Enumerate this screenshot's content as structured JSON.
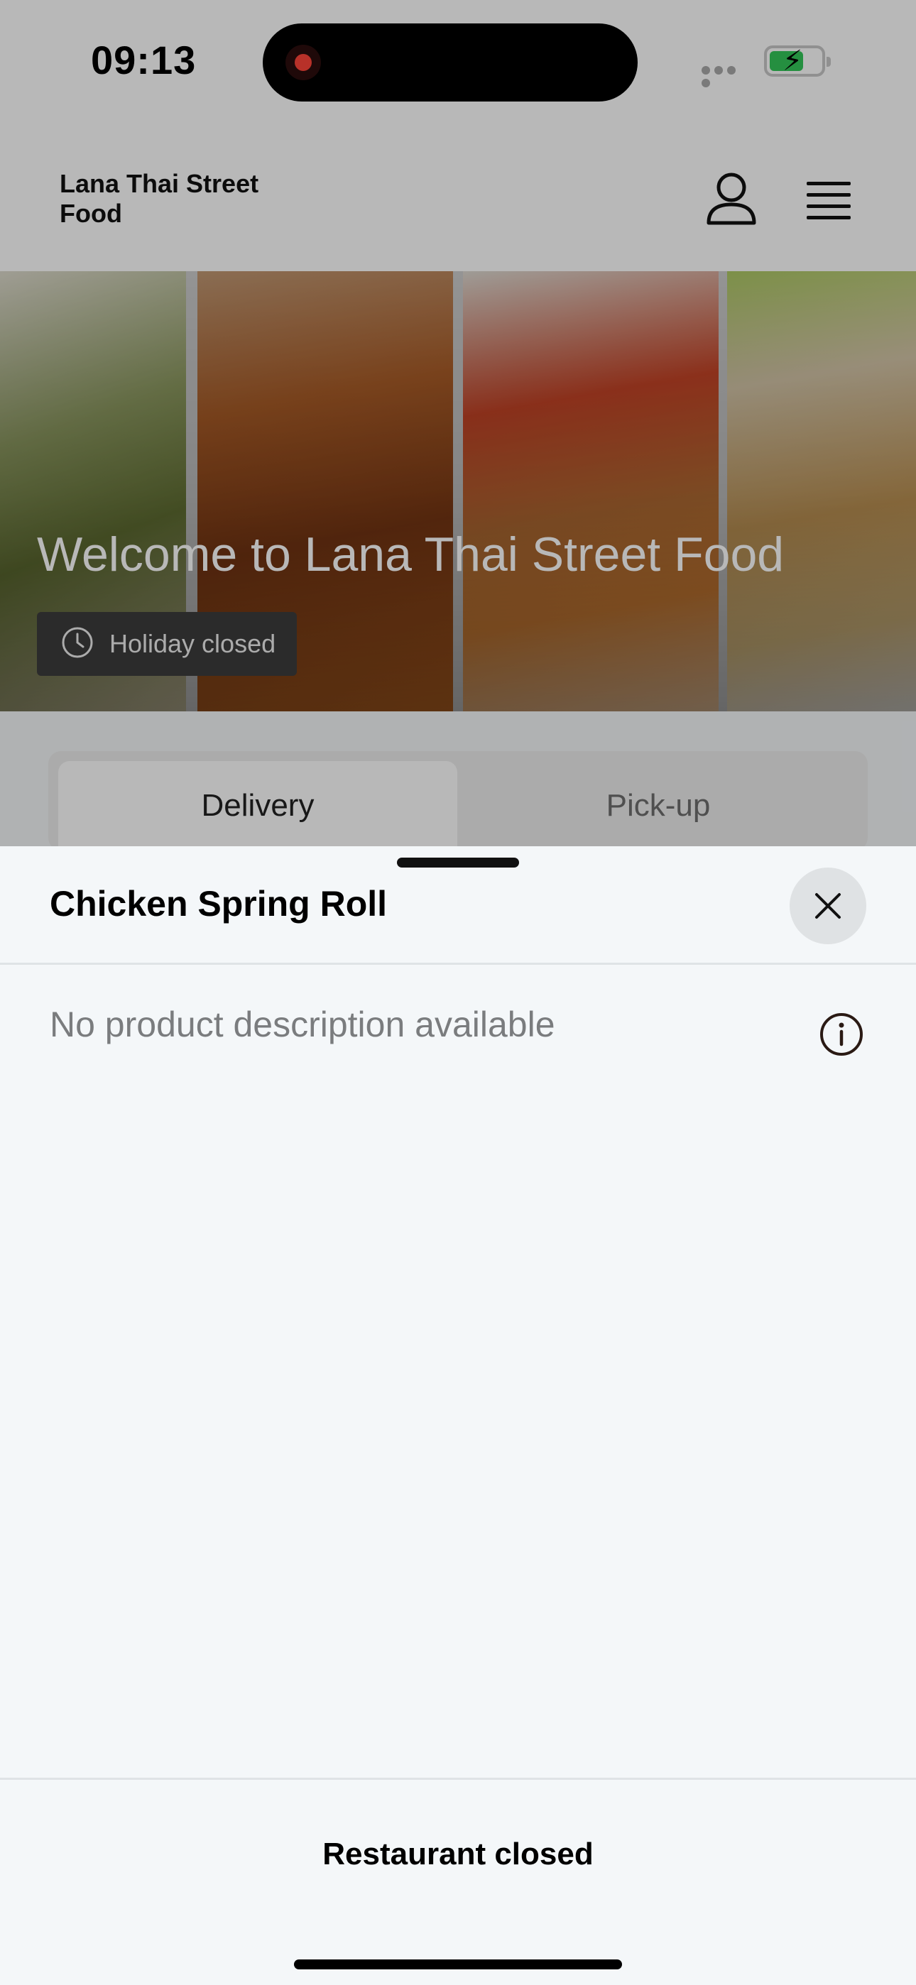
{
  "status_bar": {
    "time": "09:13"
  },
  "header": {
    "restaurant_name": "Lana Thai Street Food"
  },
  "hero": {
    "title": "Welcome to Lana Thai Street Food",
    "hours_status": "Holiday closed"
  },
  "order_mode": {
    "tabs": [
      "Delivery",
      "Pick-up"
    ],
    "selected": "Delivery"
  },
  "product_sheet": {
    "title": "Chicken Spring Roll",
    "description": "No product description available",
    "footer_status": "Restaurant closed"
  },
  "colors": {
    "record_indicator": "#ff453a",
    "battery_charging": "#34c759",
    "sheet_background": "#f4f7f9"
  },
  "icons": [
    "record-indicator-icon",
    "battery-charging-icon",
    "account-icon",
    "menu-icon",
    "clock-icon",
    "close-icon",
    "info-icon"
  ]
}
